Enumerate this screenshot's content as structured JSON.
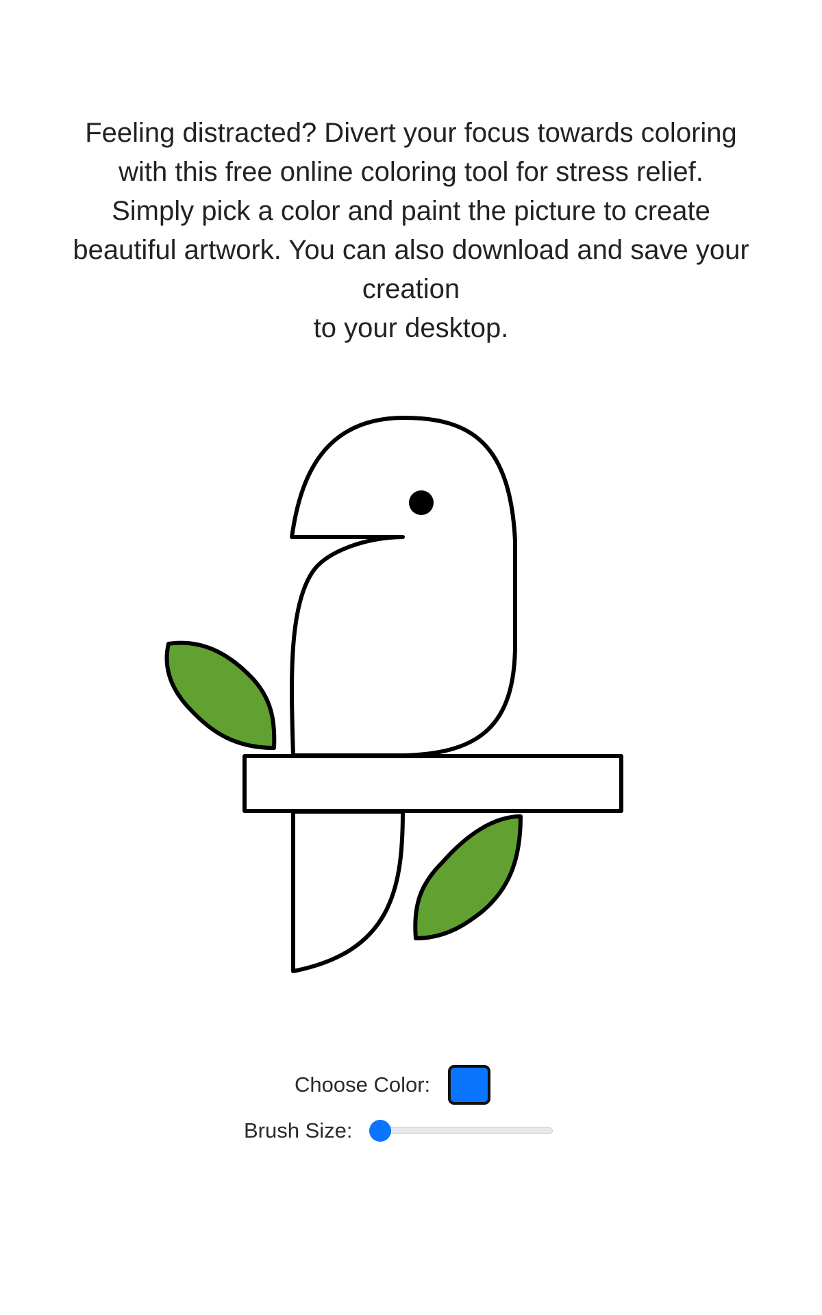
{
  "intro": {
    "lines": [
      "Feeling distracted? Divert your focus towards coloring",
      "with this free online coloring tool for stress relief.",
      "Simply pick a color and paint the picture to create",
      "beautiful artwork. You can also download and save your",
      "creation",
      "to your desktop."
    ]
  },
  "drawing": {
    "subject": "bird-on-branch",
    "leaf_color": "#61a131",
    "outline_color": "#000000",
    "fill_color": "#ffffff"
  },
  "controls": {
    "color_label": "Choose Color:",
    "selected_color": "#0a74ff",
    "brush_label": "Brush Size:",
    "brush_level": 0.0,
    "accent_color": "#0a74ff"
  }
}
